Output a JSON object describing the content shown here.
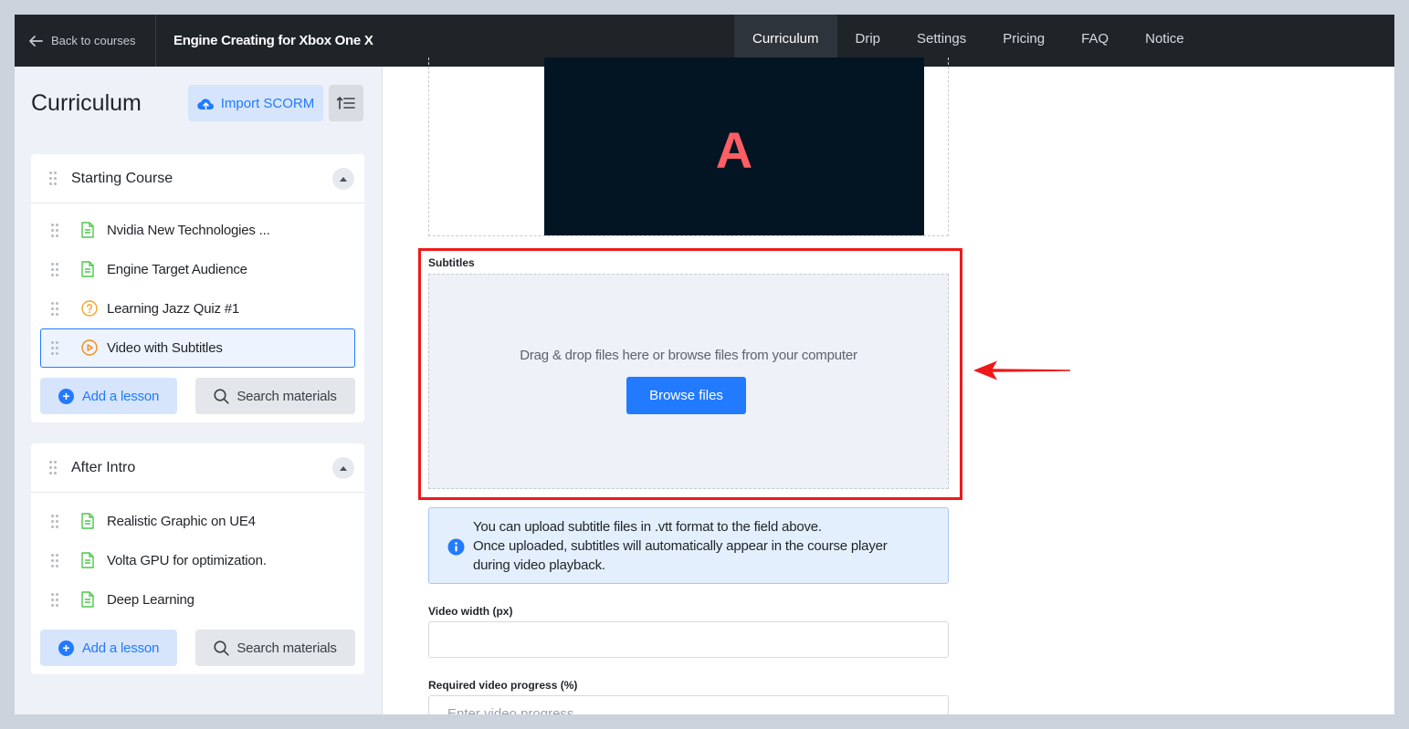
{
  "topbar": {
    "back_label": "Back to courses",
    "course_title": "Engine Creating for Xbox One X",
    "tabs": [
      {
        "label": "Curriculum",
        "active": true
      },
      {
        "label": "Drip",
        "active": false
      },
      {
        "label": "Settings",
        "active": false
      },
      {
        "label": "Pricing",
        "active": false
      },
      {
        "label": "FAQ",
        "active": false
      },
      {
        "label": "Notice",
        "active": false
      }
    ]
  },
  "sidebar": {
    "title": "Curriculum",
    "import_label": "Import SCORM",
    "sections": [
      {
        "title": "Starting Course",
        "lessons": [
          {
            "label": "Nvidia New Technologies ...",
            "icon": "document-icon"
          },
          {
            "label": "Engine Target Audience",
            "icon": "document-icon"
          },
          {
            "label": "Learning Jazz Quiz #1",
            "icon": "quiz-icon"
          },
          {
            "label": "Video with Subtitles",
            "icon": "video-icon",
            "active": true
          }
        ],
        "add_label": "Add a lesson",
        "search_label": "Search materials"
      },
      {
        "title": "After Intro",
        "lessons": [
          {
            "label": "Realistic Graphic on UE4",
            "icon": "document-icon"
          },
          {
            "label": "Volta GPU for optimization.",
            "icon": "document-icon"
          },
          {
            "label": "Deep Learning",
            "icon": "document-icon"
          }
        ],
        "add_label": "Add a lesson",
        "search_label": "Search materials"
      }
    ]
  },
  "main": {
    "video_letter": "A",
    "subtitles": {
      "label": "Subtitles",
      "drop_text": "Drag & drop files here or browse files from your computer",
      "browse_label": "Browse files"
    },
    "info_lines": [
      "You can upload subtitle files in .vtt format to the field above.",
      "Once uploaded, subtitles will automatically appear in the course player",
      "during video playback."
    ],
    "video_width": {
      "label": "Video width (px)",
      "value": ""
    },
    "required_progress": {
      "label": "Required video progress (%)",
      "placeholder": "Enter video progress"
    }
  },
  "colors": {
    "accent": "#227aff",
    "highlight": "#ef1919",
    "topbar": "#1f2429"
  }
}
